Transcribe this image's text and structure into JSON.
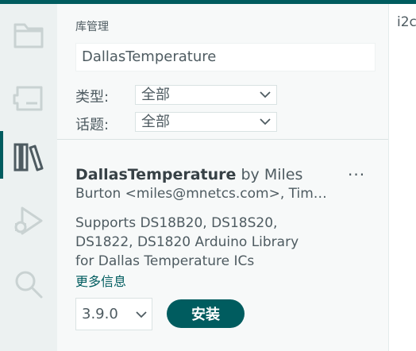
{
  "colors": {
    "accent": "#005c5f",
    "text": "#4e5b61",
    "sidebar_bg": "#ecf1f1",
    "panel_bg": "#f7f9f9"
  },
  "activity_bar": {
    "items": [
      {
        "icon": "folder-icon"
      },
      {
        "icon": "board-icon"
      },
      {
        "icon": "library-icon",
        "active": true
      },
      {
        "icon": "debug-icon"
      },
      {
        "icon": "search-icon"
      }
    ]
  },
  "library_manager": {
    "title": "库管理",
    "search_value": "DallasTemperature",
    "filters": {
      "type_label": "类型:",
      "type_value": "全部",
      "topic_label": "话题:",
      "topic_value": "全部"
    },
    "library": {
      "name": "DallasTemperature",
      "author_line1": "by Miles",
      "author_line2": "Burton <miles@mnetcs.com>, Tim…",
      "description": "Supports DS18B20, DS18S20, DS1822, DS1820 Arduino Library for Dallas Temperature ICs",
      "more_info": "更多信息",
      "more_actions": "···",
      "version": "3.9.0",
      "install_label": "安装"
    }
  },
  "editor": {
    "visible_text": "i2c"
  }
}
